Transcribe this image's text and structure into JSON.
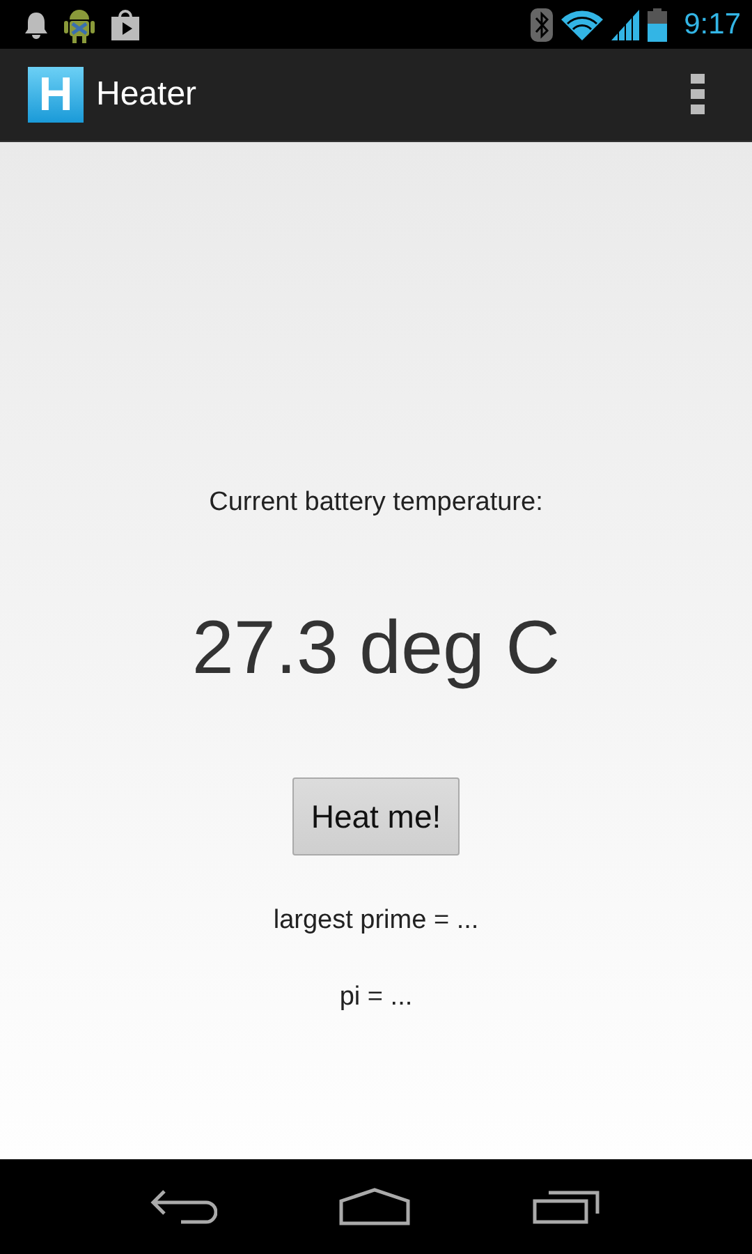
{
  "status_bar": {
    "time": "9:17"
  },
  "app_bar": {
    "icon_letter": "H",
    "title": "Heater"
  },
  "content": {
    "label": "Current battery temperature:",
    "temperature": "27.3 deg C",
    "button": "Heat me!",
    "results": [
      "largest prime = ...",
      "pi = ..."
    ]
  }
}
